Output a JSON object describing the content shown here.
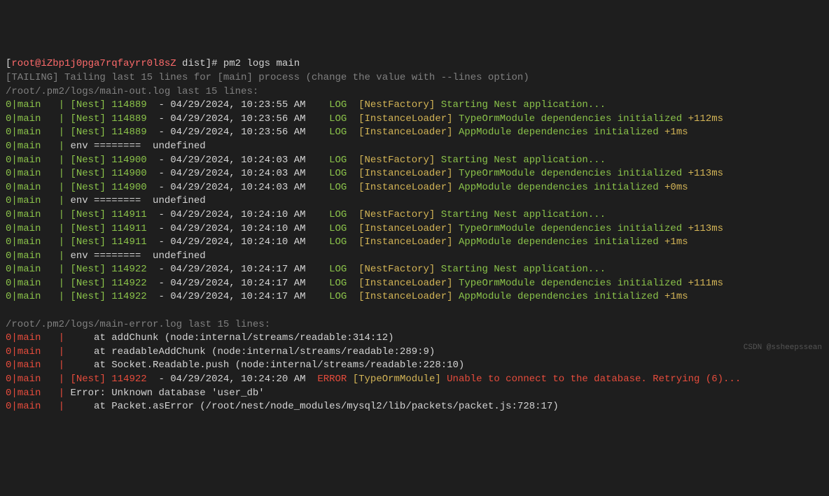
{
  "prompt": {
    "user": "root",
    "host": "iZbp1j0pga7rqfayrr0l8sZ",
    "dir": "dist",
    "symbol": "#",
    "command": "pm2 logs main"
  },
  "tailing_msg": "[TAILING] Tailing last 15 lines for [main] process (change the value with --lines option)",
  "out_log_header": "/root/.pm2/logs/main-out.log last 15 lines:",
  "err_log_header": "/root/.pm2/logs/main-error.log last 15 lines:",
  "out_lines": [
    {
      "prefix": "0|main",
      "nest": "[Nest]",
      "pid": "114889",
      "dash": "-",
      "ts": "04/29/2024, 10:23:55 AM",
      "level": "LOG",
      "ctx": "[NestFactory]",
      "msg": "Starting Nest application...",
      "suffix": ""
    },
    {
      "prefix": "0|main",
      "nest": "[Nest]",
      "pid": "114889",
      "dash": "-",
      "ts": "04/29/2024, 10:23:56 AM",
      "level": "LOG",
      "ctx": "[InstanceLoader]",
      "msg": "TypeOrmModule dependencies initialized",
      "suffix": "+112ms"
    },
    {
      "prefix": "0|main",
      "nest": "[Nest]",
      "pid": "114889",
      "dash": "-",
      "ts": "04/29/2024, 10:23:56 AM",
      "level": "LOG",
      "ctx": "[InstanceLoader]",
      "msg": "AppModule dependencies initialized",
      "suffix": "+1ms"
    },
    {
      "prefix": "0|main",
      "env": "env ========  undefined"
    },
    {
      "prefix": "0|main",
      "nest": "[Nest]",
      "pid": "114900",
      "dash": "-",
      "ts": "04/29/2024, 10:24:03 AM",
      "level": "LOG",
      "ctx": "[NestFactory]",
      "msg": "Starting Nest application...",
      "suffix": ""
    },
    {
      "prefix": "0|main",
      "nest": "[Nest]",
      "pid": "114900",
      "dash": "-",
      "ts": "04/29/2024, 10:24:03 AM",
      "level": "LOG",
      "ctx": "[InstanceLoader]",
      "msg": "TypeOrmModule dependencies initialized",
      "suffix": "+113ms"
    },
    {
      "prefix": "0|main",
      "nest": "[Nest]",
      "pid": "114900",
      "dash": "-",
      "ts": "04/29/2024, 10:24:03 AM",
      "level": "LOG",
      "ctx": "[InstanceLoader]",
      "msg": "AppModule dependencies initialized",
      "suffix": "+0ms"
    },
    {
      "prefix": "0|main",
      "env": "env ========  undefined"
    },
    {
      "prefix": "0|main",
      "nest": "[Nest]",
      "pid": "114911",
      "dash": "-",
      "ts": "04/29/2024, 10:24:10 AM",
      "level": "LOG",
      "ctx": "[NestFactory]",
      "msg": "Starting Nest application...",
      "suffix": ""
    },
    {
      "prefix": "0|main",
      "nest": "[Nest]",
      "pid": "114911",
      "dash": "-",
      "ts": "04/29/2024, 10:24:10 AM",
      "level": "LOG",
      "ctx": "[InstanceLoader]",
      "msg": "TypeOrmModule dependencies initialized",
      "suffix": "+113ms"
    },
    {
      "prefix": "0|main",
      "nest": "[Nest]",
      "pid": "114911",
      "dash": "-",
      "ts": "04/29/2024, 10:24:10 AM",
      "level": "LOG",
      "ctx": "[InstanceLoader]",
      "msg": "AppModule dependencies initialized",
      "suffix": "+1ms"
    },
    {
      "prefix": "0|main",
      "env": "env ========  undefined"
    },
    {
      "prefix": "0|main",
      "nest": "[Nest]",
      "pid": "114922",
      "dash": "-",
      "ts": "04/29/2024, 10:24:17 AM",
      "level": "LOG",
      "ctx": "[NestFactory]",
      "msg": "Starting Nest application...",
      "suffix": ""
    },
    {
      "prefix": "0|main",
      "nest": "[Nest]",
      "pid": "114922",
      "dash": "-",
      "ts": "04/29/2024, 10:24:17 AM",
      "level": "LOG",
      "ctx": "[InstanceLoader]",
      "msg": "TypeOrmModule dependencies initialized",
      "suffix": "+111ms"
    },
    {
      "prefix": "0|main",
      "nest": "[Nest]",
      "pid": "114922",
      "dash": "-",
      "ts": "04/29/2024, 10:24:17 AM",
      "level": "LOG",
      "ctx": "[InstanceLoader]",
      "msg": "AppModule dependencies initialized",
      "suffix": "+1ms"
    }
  ],
  "err_lines": [
    {
      "prefix": "0|main",
      "stack": "    at addChunk (node:internal/streams/readable:314:12)"
    },
    {
      "prefix": "0|main",
      "stack": "    at readableAddChunk (node:internal/streams/readable:289:9)"
    },
    {
      "prefix": "0|main",
      "stack": "    at Socket.Readable.push (node:internal/streams/readable:228:10)"
    },
    {
      "prefix": "0|main",
      "nest": "[Nest]",
      "pid": "114922",
      "dash": "-",
      "ts": "04/29/2024, 10:24:20 AM",
      "level": "ERROR",
      "ctx": "[TypeOrmModule]",
      "msg": "Unable to connect to the database. Retrying (6)..."
    },
    {
      "prefix": "0|main",
      "stack": "Error: Unknown database 'user_db'"
    },
    {
      "prefix": "0|main",
      "stack": "    at Packet.asError (/root/nest/node_modules/mysql2/lib/packets/packet.js:728:17)"
    }
  ],
  "watermark": "CSDN @ssheepssean"
}
